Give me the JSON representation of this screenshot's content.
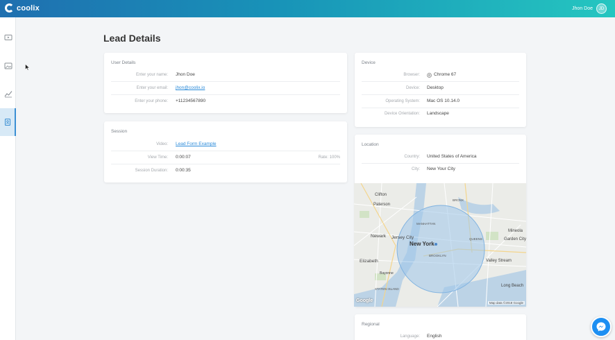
{
  "app": {
    "name": "coolix",
    "user_name": "Jhon Doe",
    "avatar_initials": "JD"
  },
  "colors": {
    "accent": "#1893b8",
    "link": "#2a8ad9",
    "messenger": "#1d8ff2"
  },
  "sidebar": {
    "items": [
      {
        "icon": "video-icon",
        "active": false
      },
      {
        "icon": "image-gallery-icon",
        "active": false
      },
      {
        "icon": "analytics-chart-icon",
        "active": false
      },
      {
        "icon": "lead-form-icon",
        "active": true
      }
    ]
  },
  "page": {
    "title": "Lead Details"
  },
  "user_details": {
    "title": "User Details",
    "rows": [
      {
        "label": "Enter your name:",
        "value": "Jhon Doe"
      },
      {
        "label": "Enter your email:",
        "value": "jhon@coolix.io"
      },
      {
        "label": "Enter your phone:",
        "value": "+11234567890"
      }
    ]
  },
  "session": {
    "title": "Session",
    "video_label": "Video:",
    "video_value": "Lead Form Example",
    "view_time_label": "View Time:",
    "view_time_value": "0:00:07",
    "rate_text": "Rate: 100%",
    "duration_label": "Session Duration:",
    "duration_value": "0:00:35"
  },
  "device": {
    "title": "Device",
    "rows": [
      {
        "label": "Browser:",
        "value": "Chrome 67",
        "icon": "chrome-icon"
      },
      {
        "label": "Device:",
        "value": "Desktop"
      },
      {
        "label": "Operating System:",
        "value": "Mac OS 10.14.0"
      },
      {
        "label": "Device Orientation:",
        "value": "Landscape"
      }
    ]
  },
  "location": {
    "title": "Location",
    "rows": [
      {
        "label": "Country:",
        "value": "United States of America"
      },
      {
        "label": "City:",
        "value": "New Your City"
      }
    ]
  },
  "map": {
    "labels": {
      "main": "New York",
      "jersey": "Jersey City",
      "newark": "Newark",
      "clifton": "Clifton",
      "paterson": "Paterson",
      "elizabeth": "Elizabeth",
      "manhattan": "MANHATTAN",
      "bronx": "BRONX",
      "queens": "QUEENS",
      "brooklyn": "BROOKLYN",
      "staten": "STATEN ISLAND",
      "garden": "Garden City",
      "valley": "Valley Stream",
      "longbeach": "Long Beach",
      "bayonne": "Bayonne",
      "mineola": "Mineola"
    },
    "attribution": "Map data ©2018 Google",
    "logo": "Google"
  },
  "regional": {
    "title": "Regional",
    "rows": [
      {
        "label": "Language:",
        "value": "English"
      }
    ]
  }
}
